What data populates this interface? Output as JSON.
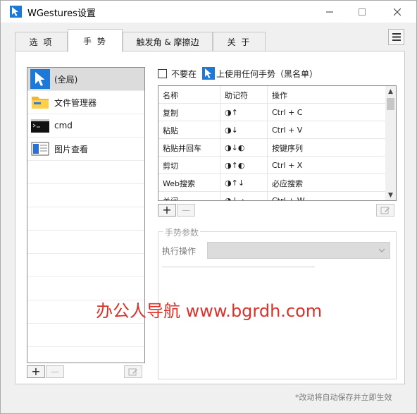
{
  "window": {
    "title": "WGestures设置",
    "controls": {
      "minimize": "—",
      "maximize": "☐",
      "close": "✕"
    }
  },
  "tabs": [
    {
      "label": "选 项",
      "active": false
    },
    {
      "label": "手 势",
      "active": true
    },
    {
      "label": "触发角 & 摩擦边",
      "active": false
    },
    {
      "label": "关 于",
      "active": false
    }
  ],
  "menu_button": {
    "icon": "hamburger-menu-icon"
  },
  "app_list": {
    "items": [
      {
        "label": "(全局)",
        "icon": "cursor-icon",
        "selected": true
      },
      {
        "label": "文件管理器",
        "icon": "folder-icon",
        "selected": false
      },
      {
        "label": "cmd",
        "icon": "terminal-icon",
        "selected": false
      },
      {
        "label": "图片查看",
        "icon": "image-viewer-icon",
        "selected": false
      }
    ],
    "add_label": "+",
    "remove_label": "—"
  },
  "blacklist": {
    "checked": false,
    "text_before": "不要在",
    "text_after": "上使用任何手势（黑名单）"
  },
  "gesture_table": {
    "headers": [
      "名称",
      "助记符",
      "操作"
    ],
    "rows": [
      {
        "name": "复制",
        "mnemonic": "◑↑",
        "action": "Ctrl + C"
      },
      {
        "name": "粘贴",
        "mnemonic": "◑↓",
        "action": "Ctrl + V"
      },
      {
        "name": "粘贴并回车",
        "mnemonic": "◑↓◐",
        "action": "按键序列"
      },
      {
        "name": "剪切",
        "mnemonic": "◑↑◐",
        "action": "Ctrl + X"
      },
      {
        "name": "Web搜索",
        "mnemonic": "◑↑↓",
        "action": "必应搜索"
      },
      {
        "name": "关闭",
        "mnemonic": "◑↓→",
        "action": "Ctrl + W"
      }
    ],
    "add_label": "+",
    "remove_label": "—"
  },
  "params": {
    "legend": "手势参数",
    "exec_label": "执行操作",
    "exec_value": ""
  },
  "watermark": "办公人导航 www.bgrdh.com",
  "footer_note": "*改动将自动保存并立即生效",
  "colors": {
    "window_bg": "#f0f0f0",
    "panel_bg": "#ffffff",
    "selected_row": "#dcdcdc",
    "watermark": "#d9322b",
    "accent_blue": "#1e78d7"
  }
}
